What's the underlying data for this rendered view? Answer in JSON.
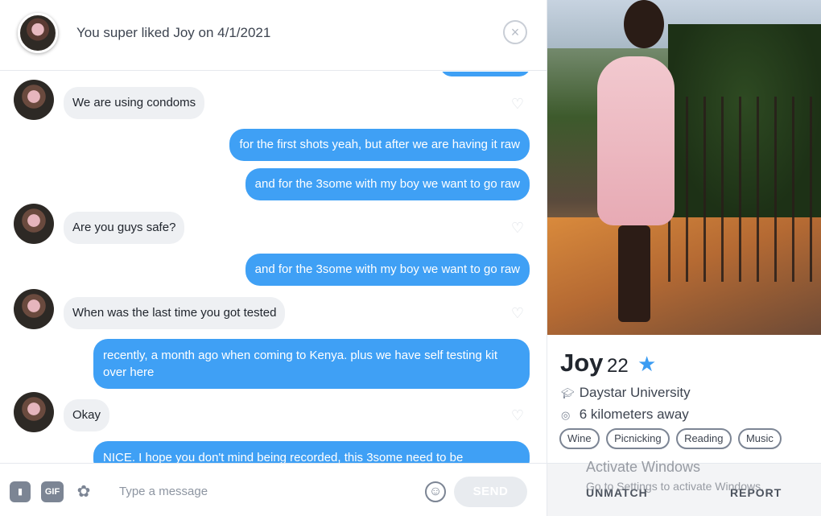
{
  "header": {
    "text": "You super liked Joy on 4/1/2021",
    "close_icon": "×"
  },
  "messages": [
    {
      "from": "them",
      "text": "We are using condoms"
    },
    {
      "from": "me",
      "text": "for the first shots yeah, but after we are having it raw"
    },
    {
      "from": "me",
      "text": "and for the 3some with my boy we want to go raw"
    },
    {
      "from": "them",
      "text": "Are you guys safe?"
    },
    {
      "from": "me",
      "text": "and for the 3some with my boy we want to go raw"
    },
    {
      "from": "them",
      "text": "When was the last time you got tested"
    },
    {
      "from": "me",
      "text": "recently, a month ago when coming to Kenya. plus we have self testing kit over here"
    },
    {
      "from": "them",
      "text": "Okay"
    },
    {
      "from": "me",
      "text": "NICE. I hope you don't mind being recorded, this 3some need to be"
    }
  ],
  "composer": {
    "gif_label": "GIF",
    "placeholder": "Type a message",
    "send_label": "SEND"
  },
  "profile": {
    "name": "Joy",
    "age": "22",
    "school": "Daystar University",
    "distance": "6 kilometers away",
    "interests": [
      "Wine",
      "Picnicking",
      "Reading",
      "Music"
    ],
    "unmatch_label": "UNMATCH",
    "report_label": "REPORT"
  },
  "os_watermark": {
    "title": "Activate Windows",
    "subtitle": "Go to Settings to activate Windows."
  },
  "colors": {
    "outgoing_bubble": "#3fa0f5",
    "incoming_bubble": "#eef0f3",
    "star": "#3b9cf2"
  }
}
